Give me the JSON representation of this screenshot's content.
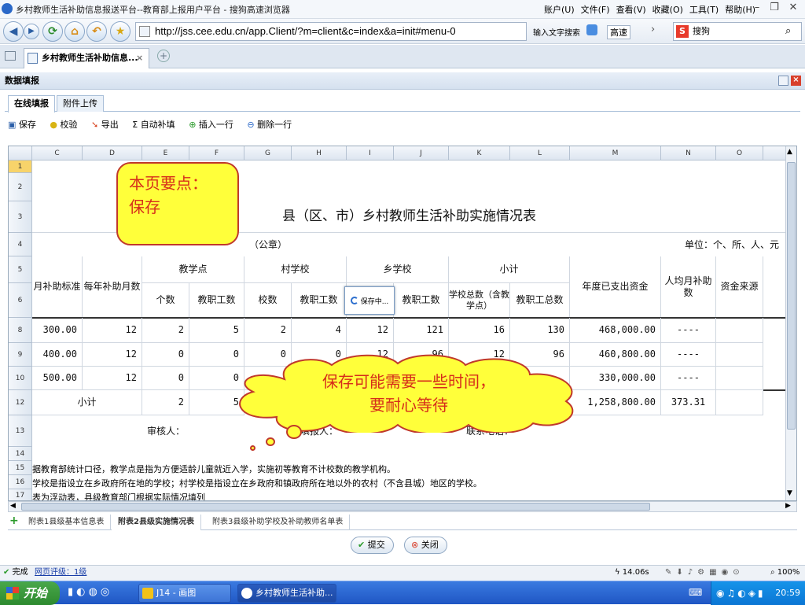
{
  "window": {
    "title": "乡村教师生活补助信息报送平台--教育部上报用户平台 - 搜狗高速浏览器",
    "menus": [
      "账户(U)",
      "文件(F)",
      "查看(V)",
      "收藏(O)",
      "工具(T)",
      "帮助(H)"
    ]
  },
  "navbar": {
    "url": "http://jss.cee.edu.cn/app.Client/?m=client&c=index&a=init#menu-0",
    "input_hint": "输入文字搜索",
    "speed": "高速",
    "search_engine": "搜狗"
  },
  "tab": {
    "label": "乡村教师生活补助信息..."
  },
  "panel": {
    "title": "数据填报",
    "subtabs": [
      "在线填报",
      "附件上传"
    ],
    "toolbar": [
      "保存",
      "校验",
      "导出",
      "自动补填",
      "插入一行",
      "删除一行"
    ]
  },
  "sheet": {
    "columns": [
      "C",
      "D",
      "E",
      "F",
      "G",
      "H",
      "I",
      "J",
      "K",
      "L",
      "M",
      "N",
      "O"
    ],
    "rows": [
      "1",
      "2",
      "3",
      "4",
      "5",
      "6",
      "8",
      "9",
      "10",
      "12",
      "13",
      "14",
      "15",
      "16",
      "17"
    ],
    "title": "县（区、市）乡村教师生活补助实施情况表",
    "seal": "（公章）",
    "unit": "单位：个、所、人、元",
    "headers": {
      "monthly_std": "月补助标准",
      "months": "每年补助月数",
      "teaching_point": "教学点",
      "village_school": "村学校",
      "town_school": "乡学校",
      "subtotal": "小计",
      "count": "个数",
      "staff": "教职工数",
      "school_count": "校数",
      "total_schools": "学校总数（含教学点）",
      "total_staff": "教职工总数",
      "annual_spent": "年度已支出资金",
      "avg_monthly": "人均月补助数",
      "fund_source": "资金来源"
    },
    "data_rows": [
      [
        "300.00",
        "12",
        "2",
        "5",
        "2",
        "4",
        "12",
        "121",
        "16",
        "130",
        "468,000.00",
        "----"
      ],
      [
        "400.00",
        "12",
        "0",
        "0",
        "0",
        "0",
        "12",
        "96",
        "12",
        "96",
        "460,800.00",
        "----"
      ],
      [
        "500.00",
        "12",
        "0",
        "0",
        "",
        "",
        "",
        "",
        "",
        "",
        "330,000.00",
        "----"
      ]
    ],
    "subtotal_row": {
      "label": "小计",
      "e": "2",
      "f": "5",
      "m": "1,258,800.00",
      "n": "373.31"
    },
    "reviewer": "审核人：",
    "filler": "填报人：",
    "phone": "联系电话：",
    "notes": [
      "据教育部统计口径，教学点是指为方便适龄儿童就近入学，实施初等教育不计校数的教学机构。",
      "学校是指设立在乡政府所在地的学校；村学校是指设立在乡政府和镇政府所在地以外的农村（不含县城）地区的学校。",
      "表为浮动表，县级教育部门根据实际情况填列"
    ],
    "saving": "保存中..."
  },
  "sheettabs": [
    "附表1县级基本信息表",
    "附表2县级实施情况表",
    "附表3县级补助学校及补助教师名单表"
  ],
  "buttons": {
    "submit": "提交",
    "close": "关闭"
  },
  "status": {
    "done": "完成",
    "rating": "网页评级：1级",
    "time": "14.06s",
    "zoom": "100%"
  },
  "taskbar": {
    "start": "开始",
    "task1": "J14 - 画图",
    "task2": "乡村教师生活补助...",
    "clock": "20:59"
  },
  "callouts": {
    "key_point": "本页要点：",
    "key_action": "保存",
    "patience_1": "保存可能需要一些时间，",
    "patience_2": "要耐心等待"
  }
}
